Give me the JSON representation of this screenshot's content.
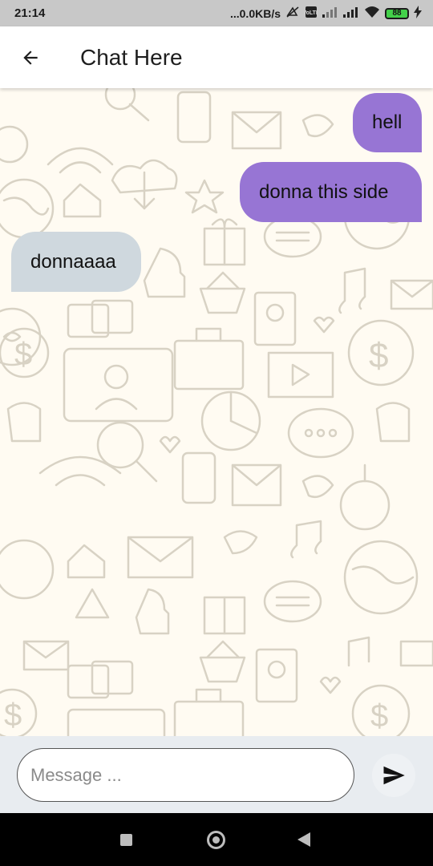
{
  "status_bar": {
    "time": "21:14",
    "network_speed": "...0.0KB/s",
    "battery_level": "88",
    "icons": [
      "mute-icon",
      "volte-icon",
      "signal-icon",
      "signal-icon",
      "wifi-icon",
      "battery-icon",
      "charging-icon"
    ]
  },
  "app_bar": {
    "title": "Chat Here",
    "back_icon": "arrow-left-icon"
  },
  "messages": [
    {
      "text": "hell",
      "direction": "sent"
    },
    {
      "text": "donna this side",
      "direction": "sent"
    },
    {
      "text": "donnaaaa",
      "direction": "received"
    }
  ],
  "composer": {
    "placeholder": "Message ...",
    "value": "",
    "send_icon": "send-icon"
  },
  "colors": {
    "sent_bubble": "#9775d4",
    "received_bubble": "#cfd8de",
    "chat_background": "#fffbf2",
    "app_bar": "#ffffff",
    "input_bar": "#e8ecf0"
  }
}
